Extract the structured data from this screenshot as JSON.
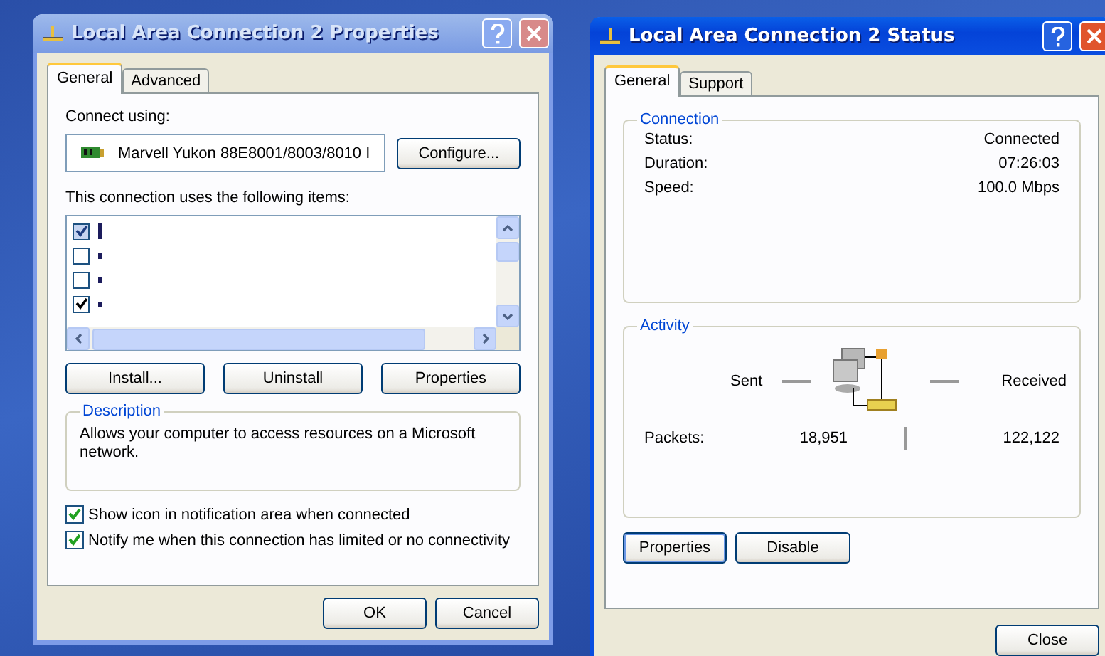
{
  "properties_window": {
    "title": "Local Area Connection 2 Properties",
    "active": false,
    "tabs": [
      {
        "label": "General",
        "selected": true
      },
      {
        "label": "Advanced",
        "selected": false
      }
    ],
    "connect_using_label": "Connect using:",
    "adapter": "Marvell Yukon 88E8001/8003/8010 I",
    "configure_button": "Configure...",
    "items_label": "This connection uses the following items:",
    "items": [
      {
        "checked": true,
        "selected": true
      },
      {
        "checked": false,
        "selected": false
      },
      {
        "checked": false,
        "selected": false
      },
      {
        "checked": true,
        "selected": false
      }
    ],
    "buttons": [
      "Install...",
      "Uninstall",
      "Properties"
    ],
    "description": {
      "title": "Description",
      "text": "Allows your computer to access resources on a Microsoft network."
    },
    "options": [
      {
        "label": "Show icon in notification area when connected",
        "checked": true
      },
      {
        "label": "Notify me when this connection has limited or no connectivity",
        "checked": true
      }
    ],
    "footer_buttons": [
      "OK",
      "Cancel"
    ]
  },
  "status_window": {
    "title": "Local Area Connection 2 Status",
    "active": true,
    "tabs": [
      {
        "label": "General",
        "selected": true
      },
      {
        "label": "Support",
        "selected": false
      }
    ],
    "connection": {
      "title": "Connection",
      "rows": [
        {
          "label": "Status:",
          "value": "Connected"
        },
        {
          "label": "Duration:",
          "value": "07:26:03"
        },
        {
          "label": "Speed:",
          "value": "100.0 Mbps"
        }
      ]
    },
    "activity": {
      "title": "Activity",
      "sent": "Sent",
      "received": "Received",
      "packets_label": "Packets:",
      "packets_sent": "18,951",
      "packets_received": "122,122"
    },
    "buttons": [
      "Properties",
      "Disable"
    ],
    "close_button": "Close"
  }
}
